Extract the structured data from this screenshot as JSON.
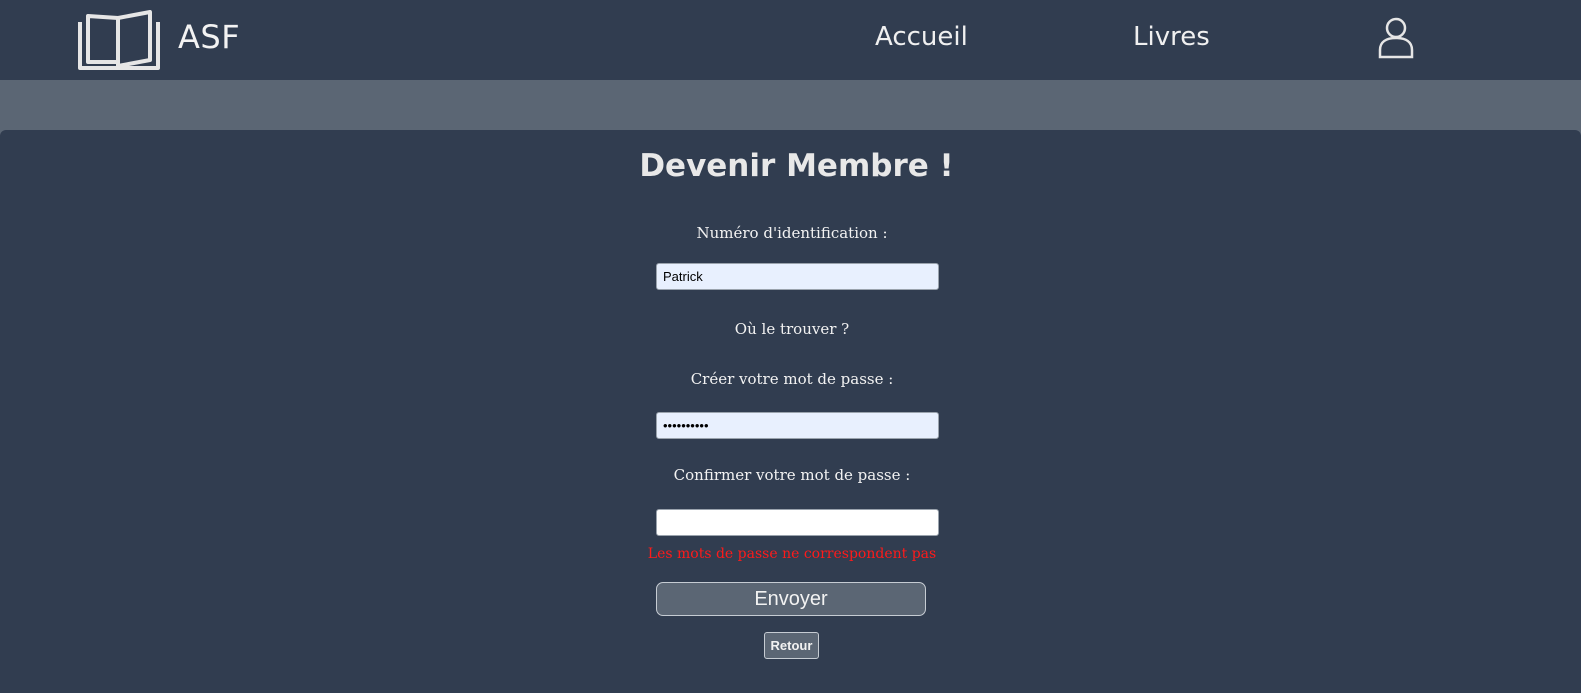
{
  "header": {
    "brand": "ASF",
    "logo_icon": "open-book-icon",
    "nav": [
      {
        "label": "Accueil"
      },
      {
        "label": "Livres"
      }
    ],
    "user_icon": "user-icon"
  },
  "form": {
    "title": "Devenir Membre !",
    "id_label": "Numéro d'identification :",
    "id_value": "Patrick",
    "where_link": "Où le trouver ?",
    "password_label": "Créer votre mot de passe :",
    "password_value": "••••••••••",
    "confirm_label": "Confirmer votre mot de passe :",
    "confirm_value": "",
    "error": "Les mots de passe ne correspondent pas",
    "submit_label": "Envoyer",
    "back_label": "Retour"
  },
  "colors": {
    "header_bg": "#313d50",
    "page_bg": "#5b6674",
    "error": "#ff1a1a",
    "autofill_bg": "#e8f0fe"
  }
}
